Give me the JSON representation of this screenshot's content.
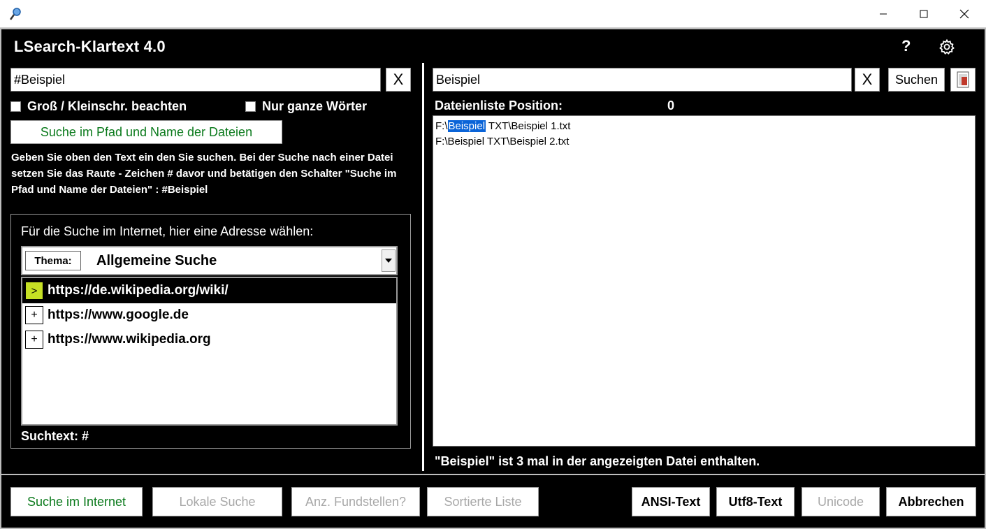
{
  "window": {
    "app_title": "LSearch-Klartext 4.0",
    "help_label": "?"
  },
  "left": {
    "search_value": "#Beispiel",
    "clear_label": "X",
    "case_label": "Groß / Kleinschr. beachten",
    "whole_words_label": "Nur ganze Wörter",
    "path_search_label": "Suche im Pfad und Name der Dateien",
    "description": "Geben Sie oben den Text ein den Sie suchen. Bei der Suche nach einer Datei setzen Sie das Raute - Zeichen # davor und betätigen den Schalter \"Suche im Pfad und Name der Dateien\" :   #Beispiel",
    "internet_prompt": "Für die Suche im Internet, hier eine Adresse wählen:",
    "thema_label": "Thema:",
    "thema_value": "Allgemeine Suche",
    "urls": [
      {
        "marker": ">",
        "url": "https://de.wikipedia.org/wiki/"
      },
      {
        "marker": "+",
        "url": "https://www.google.de"
      },
      {
        "marker": "+",
        "url": "https://www.wikipedia.org"
      }
    ],
    "suchtext": "Suchtext: #"
  },
  "right": {
    "search_value": "Beispiel",
    "clear_label": "X",
    "search_button": "Suchen",
    "position_label": "Dateienliste Position:",
    "position_value": "0",
    "files": [
      {
        "prefix": "F:\\",
        "match": "Beispiel",
        "rest": " TXT\\Beispiel 1.txt"
      },
      {
        "prefix": "F:\\Beispiel TXT\\Beispiel 2.txt",
        "match": "",
        "rest": ""
      }
    ],
    "status": "\"Beispiel\" ist 3 mal in der angezeigten Datei enthalten."
  },
  "bottom": {
    "internet": "Suche im Internet",
    "local": "Lokale Suche",
    "count": "Anz. Fundstellen?",
    "sorted": "Sortierte Liste",
    "ansi": "ANSI-Text",
    "utf8": "Utf8-Text",
    "unicode": "Unicode",
    "cancel": "Abbrechen"
  },
  "colors": {
    "accent_green": "#0b7a1c",
    "marker_active": "#c6e024",
    "highlight": "#0a64d8"
  }
}
